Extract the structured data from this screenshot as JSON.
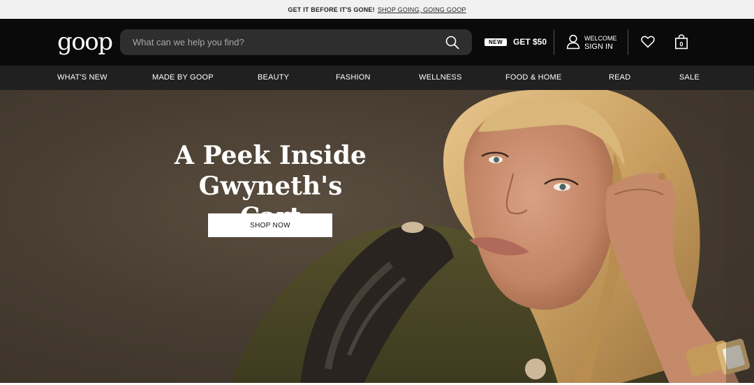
{
  "promo": {
    "text": "GET IT BEFORE IT'S GONE!",
    "link": "SHOP GOING, GOING GOOP"
  },
  "header": {
    "logo": "goop",
    "search_placeholder": "What can we help you find?",
    "new_badge": "NEW",
    "offer": "GET $50",
    "welcome": "WELCOME",
    "sign_in": "SIGN IN",
    "bag_count": "0"
  },
  "nav": {
    "items": [
      "WHAT'S NEW",
      "MADE BY GOOP",
      "BEAUTY",
      "FASHION",
      "WELLNESS",
      "FOOD & HOME",
      "READ",
      "SALE"
    ]
  },
  "hero": {
    "title_line1": "A Peek Inside",
    "title_line2": "Gwyneth's Cart",
    "cta": "SHOP NOW"
  },
  "colors": {
    "header_bg": "#0a0a0a",
    "nav_bg": "#202020",
    "hero_bg": "#473d31"
  },
  "icons": [
    "search-icon",
    "user-icon",
    "heart-icon",
    "bag-icon"
  ]
}
